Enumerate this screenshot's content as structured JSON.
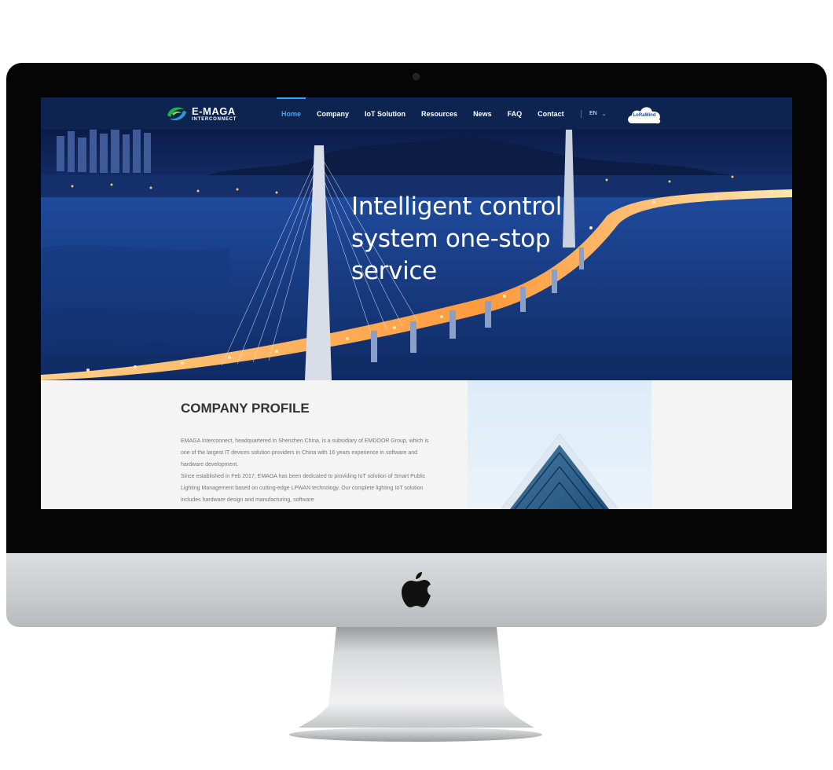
{
  "nav": {
    "logo_title": "E-MAGA",
    "logo_subtitle": "INTERCONNECT",
    "items": [
      {
        "label": "Home",
        "active": true
      },
      {
        "label": "Company"
      },
      {
        "label": "IoT Solution"
      },
      {
        "label": "Resources"
      },
      {
        "label": "News"
      },
      {
        "label": "FAQ"
      },
      {
        "label": "Contact"
      }
    ],
    "language": "EN",
    "cloud_button_label": "LoRaMind"
  },
  "hero": {
    "title": "Intelligent control system one-stop service"
  },
  "profile": {
    "heading": "COMPANY PROFILE",
    "paragraphs": [
      "EMAGA Interconnect, headquartered in Shenzhen China, is a subsidiary of EMDOOR Group, which is one of the largest IT devices solution providers in China with 16 years experience in software and hardware development.",
      "Since established in Feb 2017, EMAGA has been dedicated to providing IoT solution of Smart Public Lighting Management based on cutting-edge LPWAN technology. Our complete lighting IoT solution includes hardware design and manufacturing, software"
    ]
  },
  "colors": {
    "nav_bg": "#0e2450",
    "accent": "#3aa6ff",
    "heading": "#333333",
    "body_text": "#777777"
  },
  "icons": {
    "logo": "emaga-logo-icon",
    "language_chevron": "chevron-down-icon",
    "cloud": "cloud-icon",
    "device_brand": "apple-logo-icon"
  }
}
